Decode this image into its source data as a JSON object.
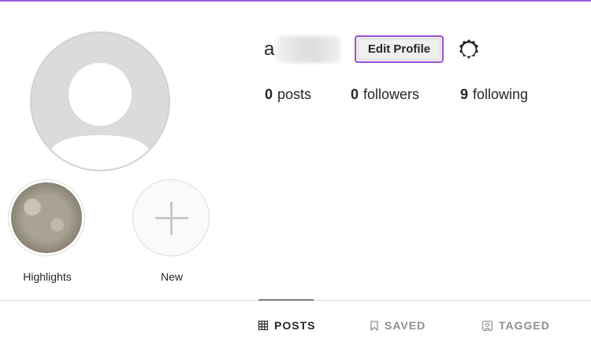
{
  "profile": {
    "username_visible": "a",
    "edit_button_label": "Edit Profile"
  },
  "stats": [
    {
      "count": "0",
      "label": "posts"
    },
    {
      "count": "0",
      "label": "followers"
    },
    {
      "count": "9",
      "label": "following"
    }
  ],
  "highlights": [
    {
      "label": "Highlights"
    },
    {
      "label": "New"
    }
  ],
  "tabs": [
    {
      "label": "POSTS",
      "icon": "grid-icon",
      "active": true
    },
    {
      "label": "SAVED",
      "icon": "bookmark-icon",
      "active": false
    },
    {
      "label": "TAGGED",
      "icon": "tagged-person-icon",
      "active": false
    }
  ],
  "colors": {
    "accent": "#a04fd6",
    "text": "#262626",
    "muted": "#8e8e8e",
    "border": "#dbdbdb"
  }
}
